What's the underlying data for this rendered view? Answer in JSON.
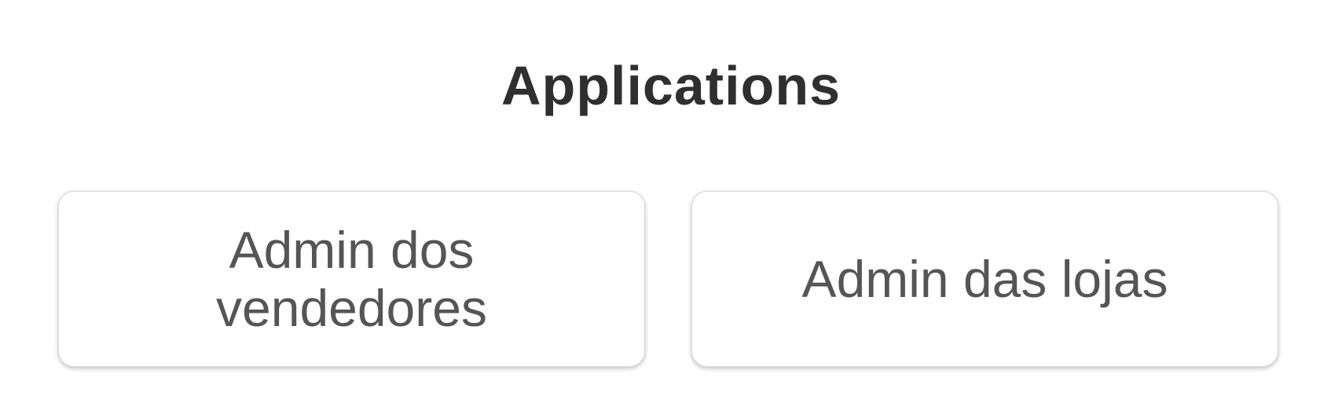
{
  "header": {
    "title": "Applications"
  },
  "apps": [
    {
      "label": "Admin dos vendedores"
    },
    {
      "label": "Admin das lojas"
    }
  ],
  "colors": {
    "title_text": "#2f2f2f",
    "card_text": "#555555",
    "card_border": "#d8d8d8",
    "background": "#ffffff"
  }
}
